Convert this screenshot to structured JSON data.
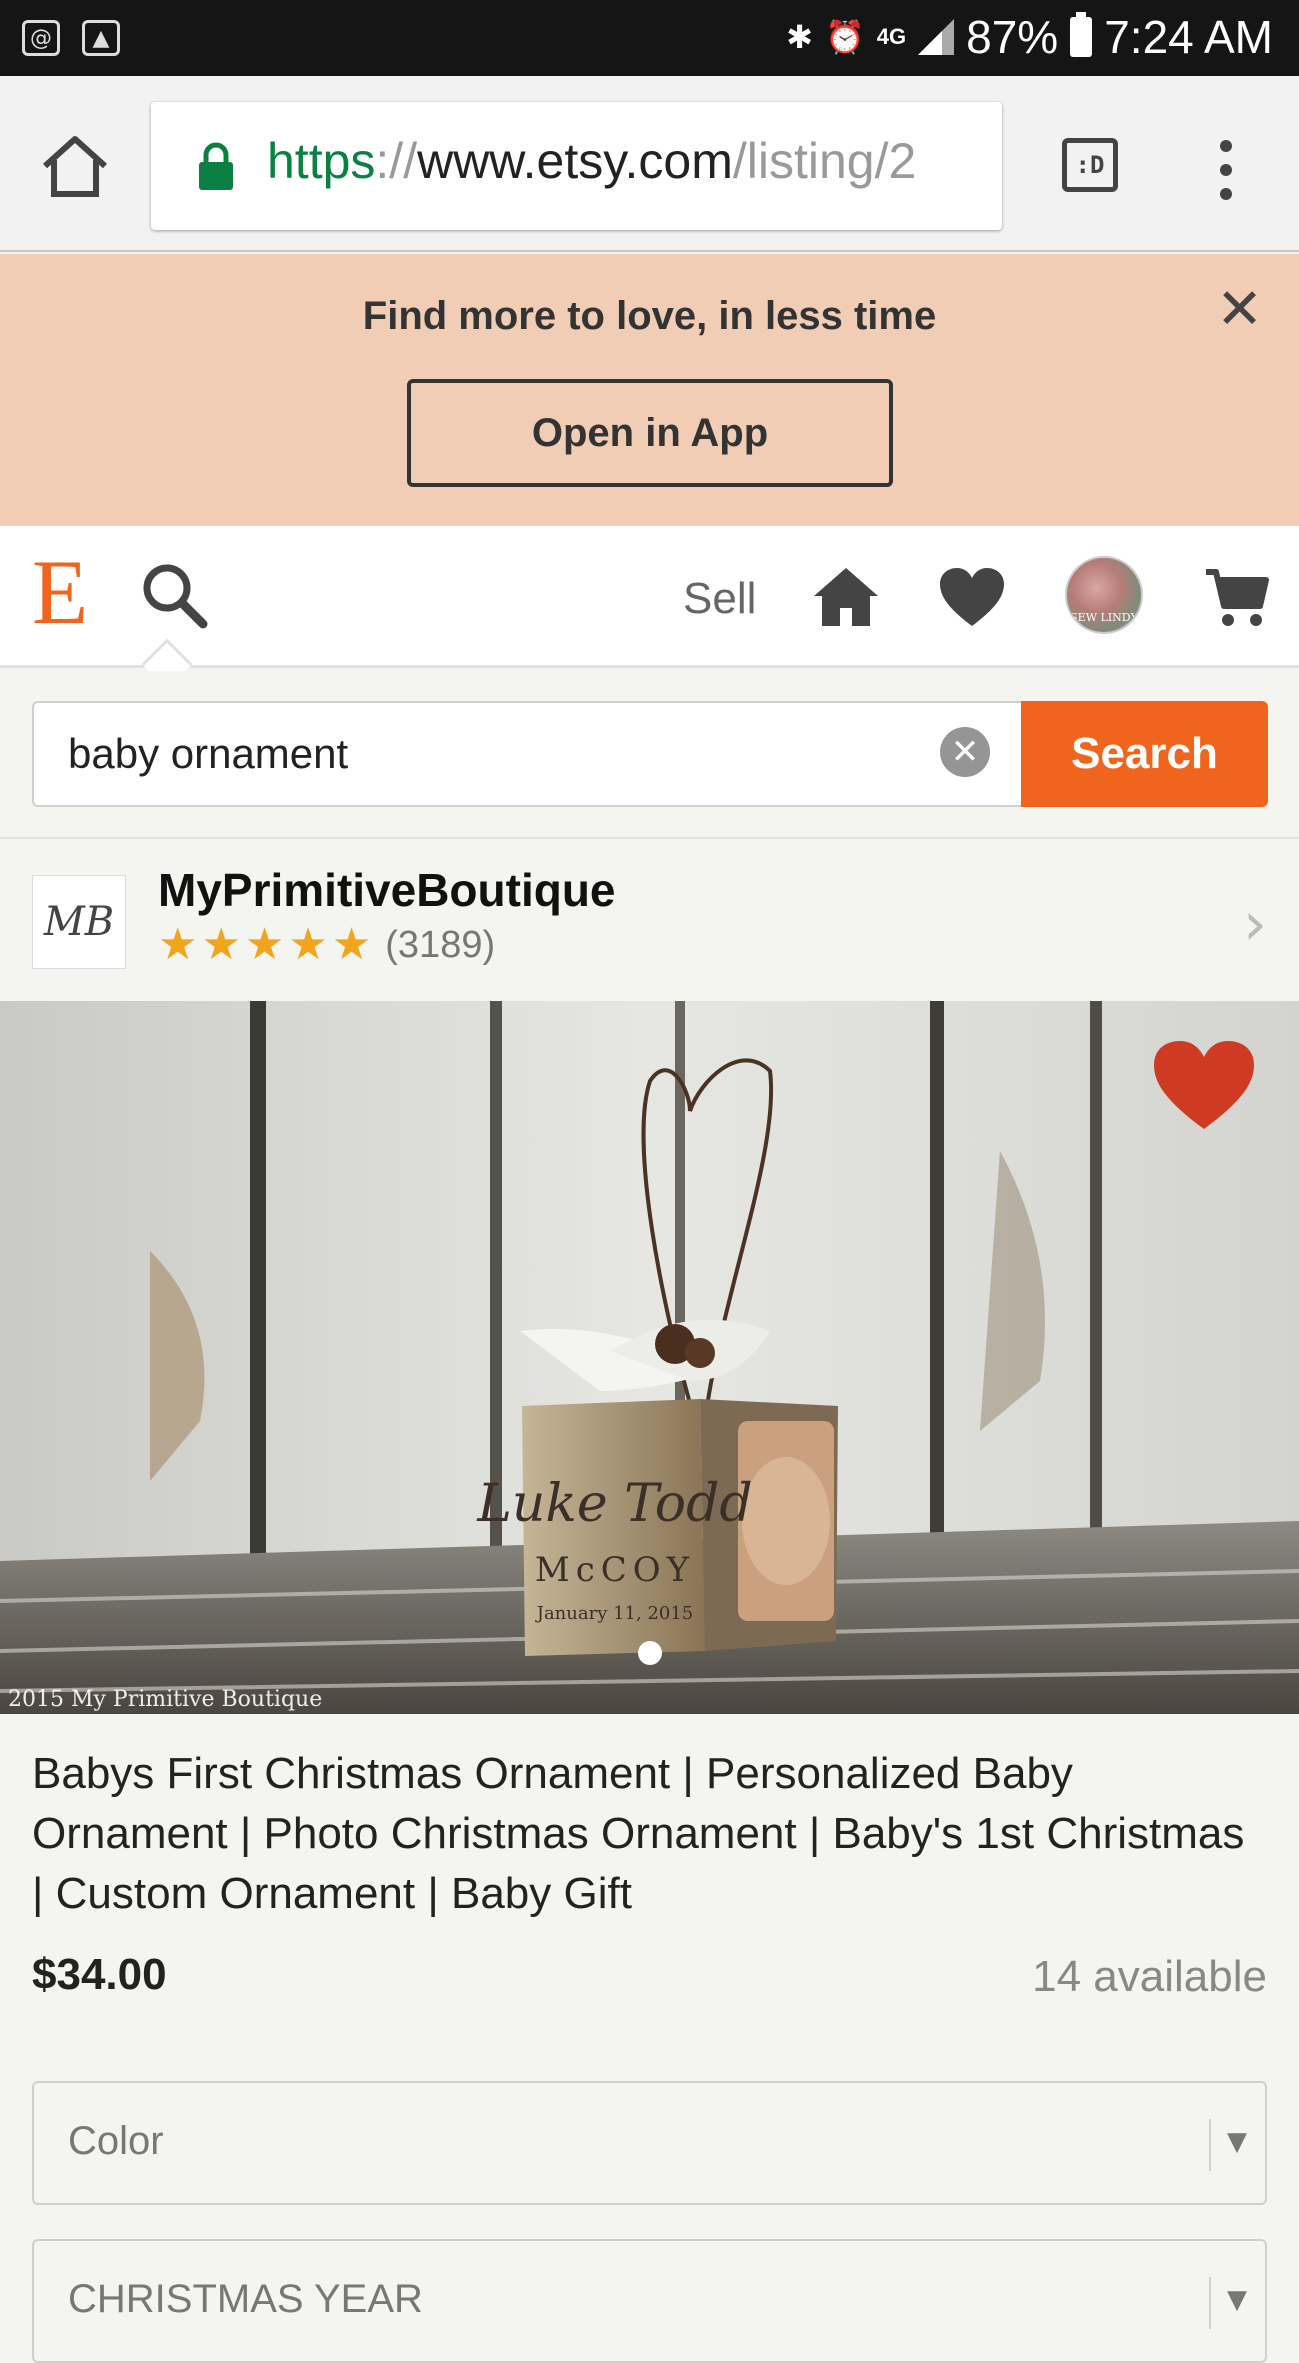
{
  "statusbar": {
    "left_icons": [
      "at-sign-notification-icon",
      "image-notification-icon"
    ],
    "network": "4G",
    "battery": "87%",
    "time": "7:24 AM"
  },
  "browser": {
    "url_scheme": "https",
    "url_sep": "://",
    "url_host": "www.etsy.com",
    "url_path": "/listing/2",
    "tabs_label": ":D"
  },
  "banner": {
    "title": "Find more to love, in less time",
    "button": "Open in App",
    "close": "✕"
  },
  "nav": {
    "logo": "E",
    "sell": "Sell",
    "avatar_text": "SEW LINDY"
  },
  "search": {
    "value": "baby ornament",
    "clear": "✕",
    "button": "Search"
  },
  "shop": {
    "logo_text": "MB",
    "name": "MyPrimitiveBoutique",
    "rating": 5,
    "stars": [
      "★",
      "★",
      "★",
      "★",
      "★"
    ],
    "reviews": "(3189)"
  },
  "photo": {
    "watermark": "2015 My Primitive Boutique",
    "block_text_1": "Luke Todd",
    "block_text_2": "McCOY",
    "block_text_3": "January 11, 2015"
  },
  "listing": {
    "title": "Babys First Christmas Ornament | Personalized Baby Ornament | Photo Christmas Ornament | Baby's 1st Christmas | Custom Ornament | Baby Gift",
    "price": "$34.00",
    "available": "14 available"
  },
  "options": [
    {
      "label": "Color"
    },
    {
      "label": "CHRISTMAS YEAR"
    }
  ]
}
